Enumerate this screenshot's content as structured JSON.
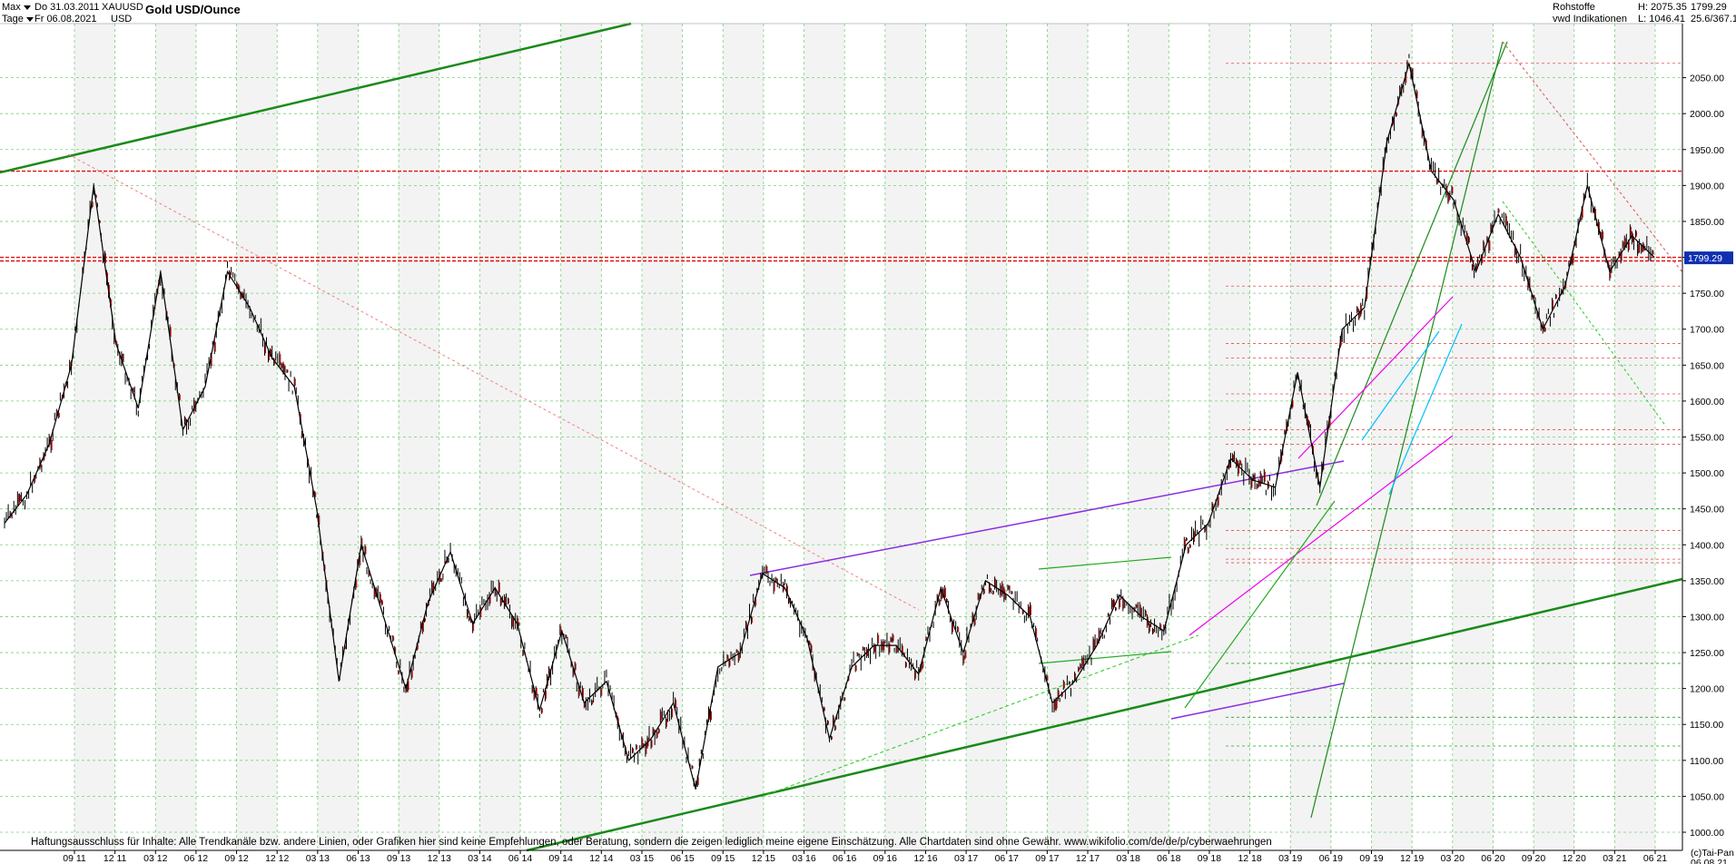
{
  "header": {
    "range_label": "Max",
    "from_date": "Do 31.03.2011",
    "symbol": "XAUUSD",
    "period_label": "Tage",
    "to_date": "Fr 06.08.2021",
    "currency": "USD",
    "title": "Gold USD/Ounce",
    "category": "Rohstoffe",
    "source": "vwd Indikationen",
    "high_text": "H: 2075.35",
    "low_text": "L: 1046.41",
    "last_value": "1799.29",
    "extra_value": "25.6/367.1"
  },
  "footer": {
    "disclaimer": "Haftungsausschluss für Inhalte: Alle Trendkanäle bzw. andere Linien, oder Grafiken hier sind keine Empfehlungen, oder Beratung, sondern die zeigen lediglich meine eigene Einschätzung. Alle Chartdaten sind ohne Gewähr.  www.wikifolio.com/de/de/p/cyberwaehrungen",
    "copyright": "(c)Tai-Pan",
    "end_date": "06.08.21"
  },
  "chart_data": {
    "type": "line",
    "title": "Gold USD/Ounce",
    "ylim": [
      1000,
      2100
    ],
    "grid": true,
    "y_ticks": [
      1000,
      1050,
      1100,
      1150,
      1200,
      1250,
      1300,
      1350,
      1400,
      1450,
      1500,
      1550,
      1600,
      1650,
      1700,
      1750,
      1800,
      1850,
      1900,
      1950,
      2000,
      2050
    ],
    "x_ticks": [
      "09 11",
      "12 11",
      "03 12",
      "06 12",
      "09 12",
      "12 12",
      "03 13",
      "06 13",
      "09 13",
      "12 13",
      "03 14",
      "06 14",
      "09 14",
      "12 14",
      "03 15",
      "06 15",
      "09 15",
      "12 15",
      "03 16",
      "06 16",
      "09 16",
      "12 16",
      "03 17",
      "06 17",
      "09 17",
      "12 17",
      "03 18",
      "06 18",
      "09 18",
      "12 18",
      "03 19",
      "06 19",
      "09 19",
      "12 19",
      "03 20",
      "06 20",
      "09 20",
      "12 20",
      "03 21",
      "06 21"
    ],
    "last_price": 1799.29,
    "series": [
      {
        "x": [
          "03 11",
          "04 11",
          "06 11",
          "08 11",
          "09 11",
          "10 11",
          "12 11",
          "02 12",
          "05 12",
          "07 12",
          "09 12",
          "10 12",
          "12 12",
          "02 13",
          "04 13",
          "06 13",
          "08 13",
          "10 13",
          "12 13",
          "02 14",
          "03 14",
          "05 14",
          "07 14",
          "08 14",
          "11 14",
          "01 15",
          "03 15",
          "05 15",
          "07 15",
          "08 15",
          "10 15",
          "12 15",
          "02 16",
          "04 16",
          "07 16",
          "09 16",
          "10 16",
          "12 16",
          "02 17",
          "04 17",
          "06 17",
          "07 17",
          "09 17",
          "12 17",
          "01 18",
          "03 18",
          "05 18",
          "08 18",
          "10 18",
          "12 18",
          "02 19",
          "03 19",
          "05 19",
          "06 19",
          "07 19",
          "09 19",
          "10 19",
          "12 19",
          "02 20",
          "03 20",
          "04 20",
          "06 20",
          "07 20",
          "08 20",
          "09 20",
          "11 20",
          "12 20",
          "01 21",
          "02 21",
          "03 21",
          "04 21",
          "05 21",
          "06 21",
          "07 21",
          "08 21"
        ],
        "values": [
          1430,
          1470,
          1540,
          1650,
          1900,
          1680,
          1590,
          1780,
          1560,
          1620,
          1780,
          1730,
          1660,
          1620,
          1450,
          1210,
          1400,
          1300,
          1200,
          1320,
          1390,
          1290,
          1340,
          1290,
          1170,
          1280,
          1180,
          1210,
          1100,
          1130,
          1180,
          1060,
          1230,
          1250,
          1360,
          1340,
          1270,
          1130,
          1230,
          1260,
          1260,
          1220,
          1340,
          1250,
          1350,
          1330,
          1300,
          1180,
          1210,
          1260,
          1330,
          1300,
          1280,
          1400,
          1430,
          1520,
          1490,
          1480,
          1640,
          1480,
          1700,
          1730,
          1960,
          2070,
          1920,
          1880,
          1780,
          1860,
          1800,
          1700,
          1760,
          1900,
          1780,
          1830,
          1800
        ]
      }
    ],
    "horizontal_lines": [
      1920,
      1800,
      1795,
      1760,
      1680,
      1660,
      1610,
      1560,
      1540,
      1450,
      1420,
      1395,
      1380,
      1375,
      1235,
      1160,
      1120,
      1050,
      2070
    ],
    "annotation": "1799.29"
  }
}
